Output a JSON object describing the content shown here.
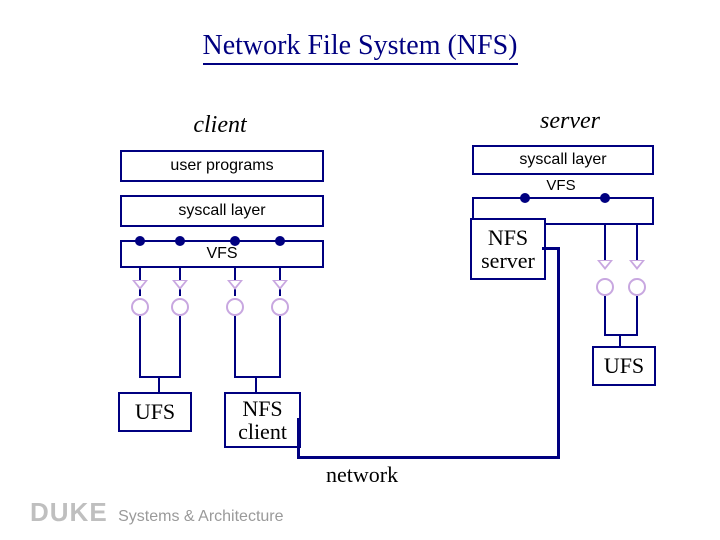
{
  "title": "Network File System (NFS)",
  "client": {
    "heading": "client",
    "boxes": {
      "user_programs": "user programs",
      "syscall_layer": "syscall layer",
      "vfs": "VFS"
    },
    "leaves": {
      "ufs": "UFS",
      "nfs_client": "NFS\nclient"
    }
  },
  "server": {
    "heading": "server",
    "boxes": {
      "syscall_layer": "syscall layer",
      "vfs": "VFS",
      "nfs_server": "NFS\nserver"
    },
    "leaves": {
      "ufs": "UFS"
    }
  },
  "network_label": "network",
  "footer": {
    "brand": "DUKE",
    "sub": "Systems & Architecture"
  },
  "chart_data": {
    "type": "diagram",
    "title": "Network File System (NFS)",
    "nodes": [
      {
        "id": "client_user_programs",
        "label": "user programs",
        "group": "client"
      },
      {
        "id": "client_syscall_layer",
        "label": "syscall layer",
        "group": "client"
      },
      {
        "id": "client_vfs",
        "label": "VFS",
        "group": "client"
      },
      {
        "id": "client_ufs",
        "label": "UFS",
        "group": "client"
      },
      {
        "id": "client_nfs_client",
        "label": "NFS client",
        "group": "client"
      },
      {
        "id": "server_syscall_layer",
        "label": "syscall layer",
        "group": "server"
      },
      {
        "id": "server_vfs",
        "label": "VFS",
        "group": "server"
      },
      {
        "id": "server_nfs_server",
        "label": "NFS server",
        "group": "server"
      },
      {
        "id": "server_ufs",
        "label": "UFS",
        "group": "server"
      },
      {
        "id": "network",
        "label": "network",
        "group": "link"
      }
    ],
    "edges": [
      {
        "from": "client_user_programs",
        "to": "client_syscall_layer"
      },
      {
        "from": "client_syscall_layer",
        "to": "client_vfs"
      },
      {
        "from": "client_vfs",
        "to": "client_ufs"
      },
      {
        "from": "client_vfs",
        "to": "client_nfs_client"
      },
      {
        "from": "client_nfs_client",
        "to": "network"
      },
      {
        "from": "network",
        "to": "server_nfs_server"
      },
      {
        "from": "server_syscall_layer",
        "to": "server_vfs"
      },
      {
        "from": "server_vfs",
        "to": "server_nfs_server"
      },
      {
        "from": "server_vfs",
        "to": "server_ufs"
      }
    ]
  }
}
